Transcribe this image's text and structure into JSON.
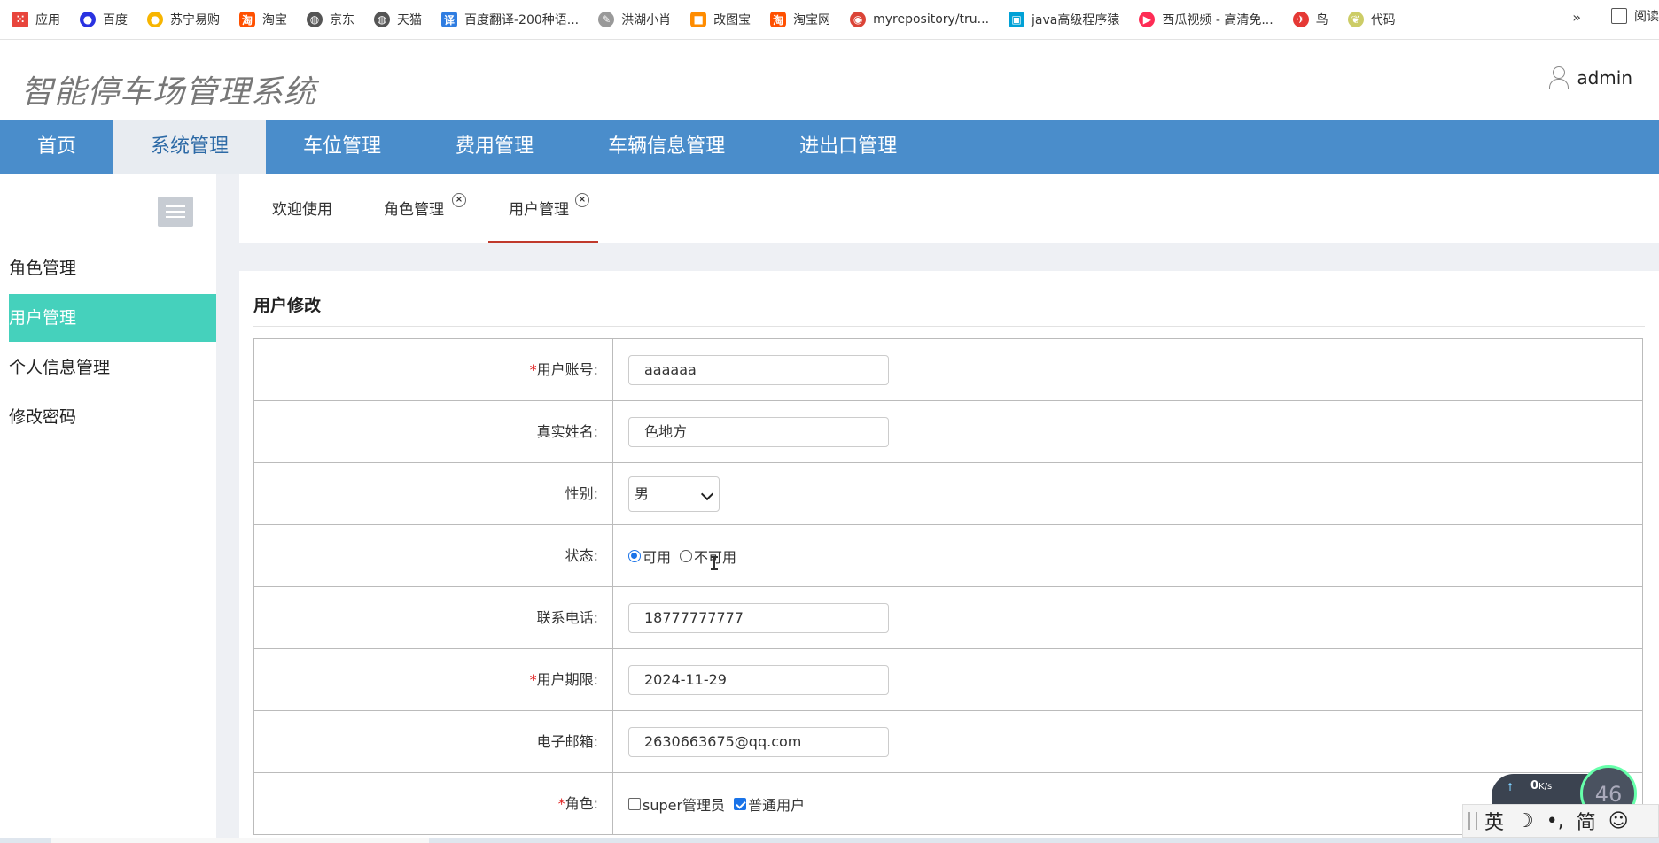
{
  "bookmarks": [
    {
      "label": "应用",
      "icon": "apps-grid-icon",
      "color": "#e8453c"
    },
    {
      "label": "百度",
      "icon": "baidu-paw-icon",
      "color": "#2932e1"
    },
    {
      "label": "苏宁易购",
      "icon": "suning-lion-icon",
      "color": "#f7b500"
    },
    {
      "label": "淘宝",
      "icon": "taobao-icon",
      "color": "#ff5000"
    },
    {
      "label": "京东",
      "icon": "globe-icon",
      "color": "#555555"
    },
    {
      "label": "天猫",
      "icon": "globe-icon",
      "color": "#555555"
    },
    {
      "label": "百度翻译-200种语...",
      "icon": "translate-icon",
      "color": "#2f7de1"
    },
    {
      "label": "洪湖小肖",
      "icon": "feather-icon",
      "color": "#777777"
    },
    {
      "label": "改图宝",
      "icon": "orange-app-icon",
      "color": "#ff8c00"
    },
    {
      "label": "淘宝网",
      "icon": "taobao-icon",
      "color": "#ff5000"
    },
    {
      "label": "myrepository/tru...",
      "icon": "chrome-icon",
      "color": "#db4437"
    },
    {
      "label": "java高级程序猿",
      "icon": "bilibili-icon",
      "color": "#00a1d6"
    },
    {
      "label": "西瓜视频 - 高清免...",
      "icon": "xigua-icon",
      "color": "#fe2c55"
    },
    {
      "label": "鸟",
      "icon": "bird-icon",
      "color": "#e53935"
    },
    {
      "label": "代码",
      "icon": "leaf-icon",
      "color": "#cccc66"
    }
  ],
  "bookmarks_more": "»",
  "reader_mode": "阅读",
  "header": {
    "title": "智能停车场管理系统",
    "username": "admin"
  },
  "nav": [
    {
      "label": "首页",
      "active": false
    },
    {
      "label": "系统管理",
      "active": true
    },
    {
      "label": "车位管理",
      "active": false
    },
    {
      "label": "费用管理",
      "active": false
    },
    {
      "label": "车辆信息管理",
      "active": false
    },
    {
      "label": "进出口管理",
      "active": false
    }
  ],
  "sidebar": {
    "items": [
      {
        "label": "角色管理",
        "active": false
      },
      {
        "label": "用户管理",
        "active": true
      },
      {
        "label": "个人信息管理",
        "active": false
      },
      {
        "label": "修改密码",
        "active": false
      }
    ]
  },
  "tabs": [
    {
      "label": "欢迎使用",
      "closable": false
    },
    {
      "label": "角色管理",
      "closable": true
    },
    {
      "label": "用户管理",
      "closable": true,
      "active": true
    }
  ],
  "tab_close_glyph": "×",
  "form": {
    "title": "用户修改",
    "required_mark": "*",
    "account": {
      "label": "用户账号:",
      "value": "aaaaaa"
    },
    "realname": {
      "label": "真实姓名:",
      "value": "色地方"
    },
    "gender": {
      "label": "性别:",
      "value": "男"
    },
    "status": {
      "label": "状态:",
      "options": [
        "可用",
        "不可用"
      ],
      "selected": "可用"
    },
    "phone": {
      "label": "联系电话:",
      "value": "18777777777"
    },
    "expiry": {
      "label": "用户期限:",
      "value": "2024-11-29"
    },
    "email": {
      "label": "电子邮箱:",
      "value": "2630663675@qq.com"
    },
    "role": {
      "label": "角色:",
      "options": [
        "super管理员",
        "普通用户"
      ],
      "checked": [
        "普通用户"
      ]
    }
  },
  "speed_widget": {
    "arrow": "↑",
    "rate": "0",
    "unit": "K/s",
    "percent": "46"
  },
  "ime": {
    "lang": "英",
    "moon": "☽",
    "punct": "•,",
    "mode": "简",
    "emoji": "☺"
  },
  "colors": {
    "nav_bg": "#4a8dcb",
    "sidebar_active": "#45d1bc",
    "required": "#e02020"
  }
}
